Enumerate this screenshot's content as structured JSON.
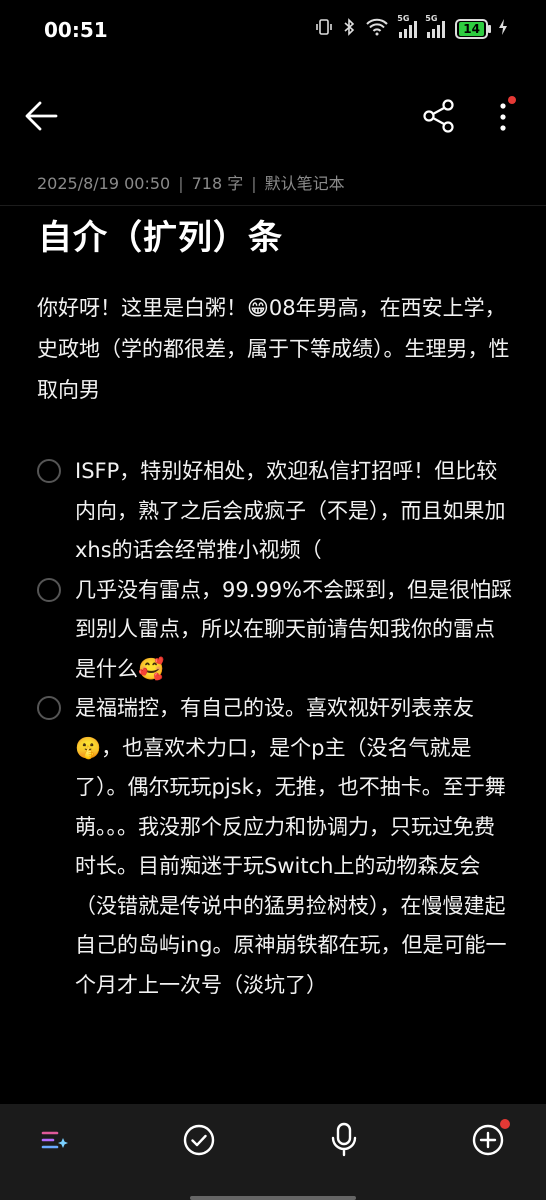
{
  "status_bar": {
    "time": "00:51",
    "network_label_1": "5G",
    "network_label_2": "5G",
    "battery": "14"
  },
  "icons": {
    "back": "arrow-left-icon",
    "share": "share-icon",
    "more": "more-vertical-icon",
    "ai": "ai-sparkle-icon",
    "check": "check-circle-icon",
    "mic": "microphone-icon",
    "add": "plus-circle-icon"
  },
  "colors": {
    "background": "#000000",
    "bottom_bar": "#1b1b1b",
    "accent_red": "#e53935",
    "battery_green": "#2ecc40"
  },
  "note": {
    "date": "2025/8/19 00:50",
    "separator": "|",
    "word_count": "718 字",
    "notebook": "默认笔记本",
    "title": "自介（扩列）条",
    "intro": "你好呀！这里是白粥！😁08年男高，在西安上学，史政地（学的都很差，属于下等成绩）。生理男，性取向男",
    "checklist": [
      {
        "text": "ISFP，特别好相处，欢迎私信打招呼！但比较内向，熟了之后会成疯子（不是），而且如果加xhs的话会经常推小视频（",
        "checked": false
      },
      {
        "text": "几乎没有雷点，99.99%不会踩到，但是很怕踩到别人雷点，所以在聊天前请告知我你的雷点是什么🥰",
        "checked": false
      },
      {
        "text": "是福瑞控，有自己的设。喜欢视奸列表亲友🤫，也喜欢术力口，是个p主（没名气就是了）。偶尔玩玩pjsk，无推，也不抽卡。至于舞萌。。。我没那个反应力和协调力，只玩过免费时长。目前痴迷于玩Switch上的动物森友会（没错就是传说中的猛男捡树枝），在慢慢建起自己的岛屿ing。原神崩铁都在玩，但是可能一个月才上一次号（淡坑了）",
        "checked": false
      }
    ]
  }
}
